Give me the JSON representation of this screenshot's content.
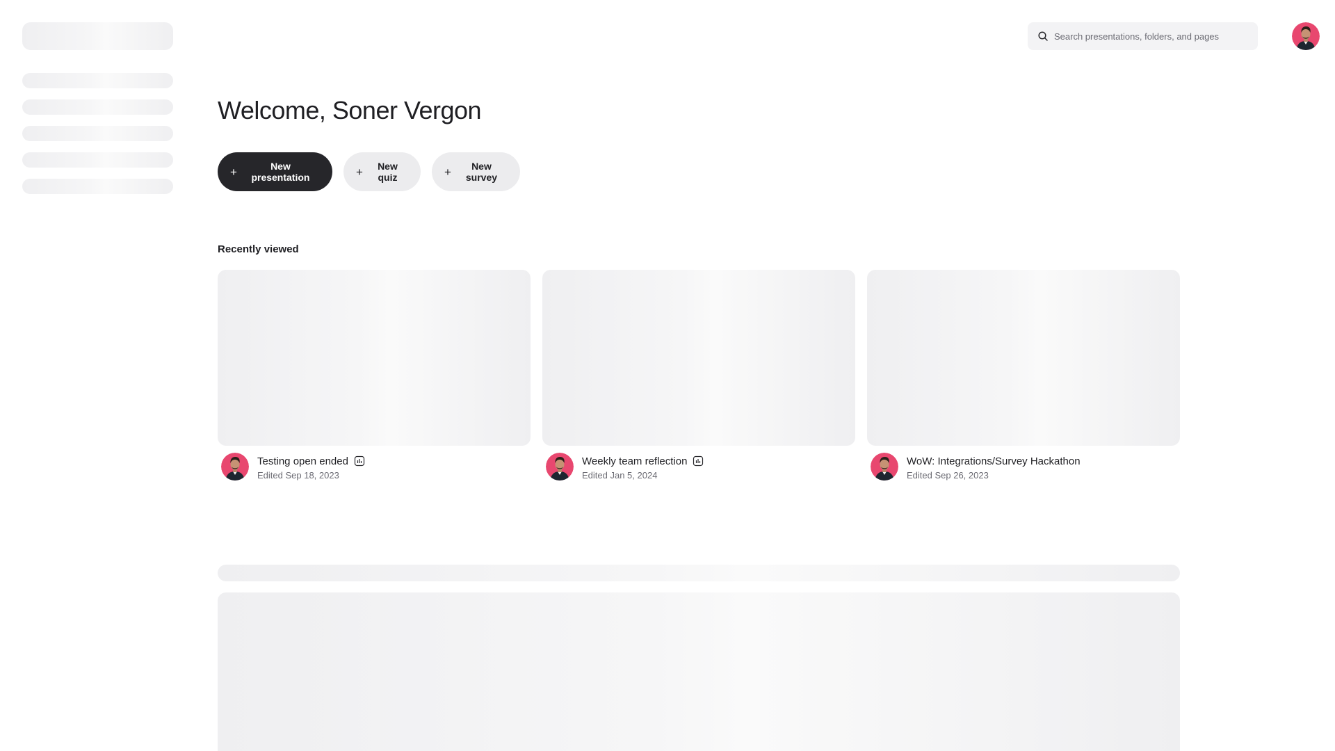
{
  "search": {
    "placeholder": "Search presentations, folders, and pages"
  },
  "main": {
    "welcome": "Welcome, Soner Vergon",
    "actions": {
      "new_presentation": "New presentation",
      "new_quiz": "New quiz",
      "new_survey": "New survey"
    },
    "recently_viewed": {
      "title": "Recently viewed",
      "items": [
        {
          "title": "Testing open ended",
          "edited": "Edited Sep 18, 2023",
          "type_icon": "bar-chart-icon"
        },
        {
          "title": "Weekly team reflection",
          "edited": "Edited Jan 5, 2024",
          "type_icon": "bar-chart-icon"
        },
        {
          "title": "WoW: Integrations/Survey Hackathon",
          "edited": "Edited Sep 26, 2023",
          "type_icon": ""
        }
      ]
    }
  },
  "colors": {
    "primary_button": "#26262a",
    "secondary_button": "#ececee",
    "avatar_bg": "#e8476f",
    "skeleton": "#efeff1"
  },
  "icons": {
    "search": "search-icon",
    "plus": "plus-icon",
    "avatar": "avatar"
  }
}
